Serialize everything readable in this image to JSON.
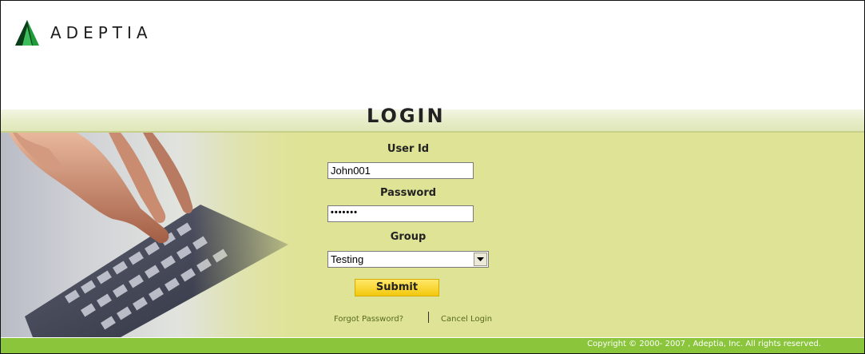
{
  "brand": {
    "name": "ADEPTIA",
    "mark_color": "#1f9b3a",
    "mark_dark": "#0b3d1a"
  },
  "login": {
    "title": "LOGIN"
  },
  "form": {
    "user_id_label": "User Id",
    "user_id_value": "John001",
    "password_label": "Password",
    "password_value": "•••••••",
    "group_label": "Group",
    "group_value": "Testing",
    "submit_label": "Submit"
  },
  "links": {
    "forgot_password": "Forgot Password?",
    "cancel_login": "Cancel Login"
  },
  "footer": {
    "copyright": "Copyright © 2000- 2007 , Adeptia, Inc. All rights reserved."
  },
  "colors": {
    "panel": "#dfe396",
    "footer": "#8ac53c",
    "submit": "#f2c80d",
    "link": "#556b1f"
  }
}
